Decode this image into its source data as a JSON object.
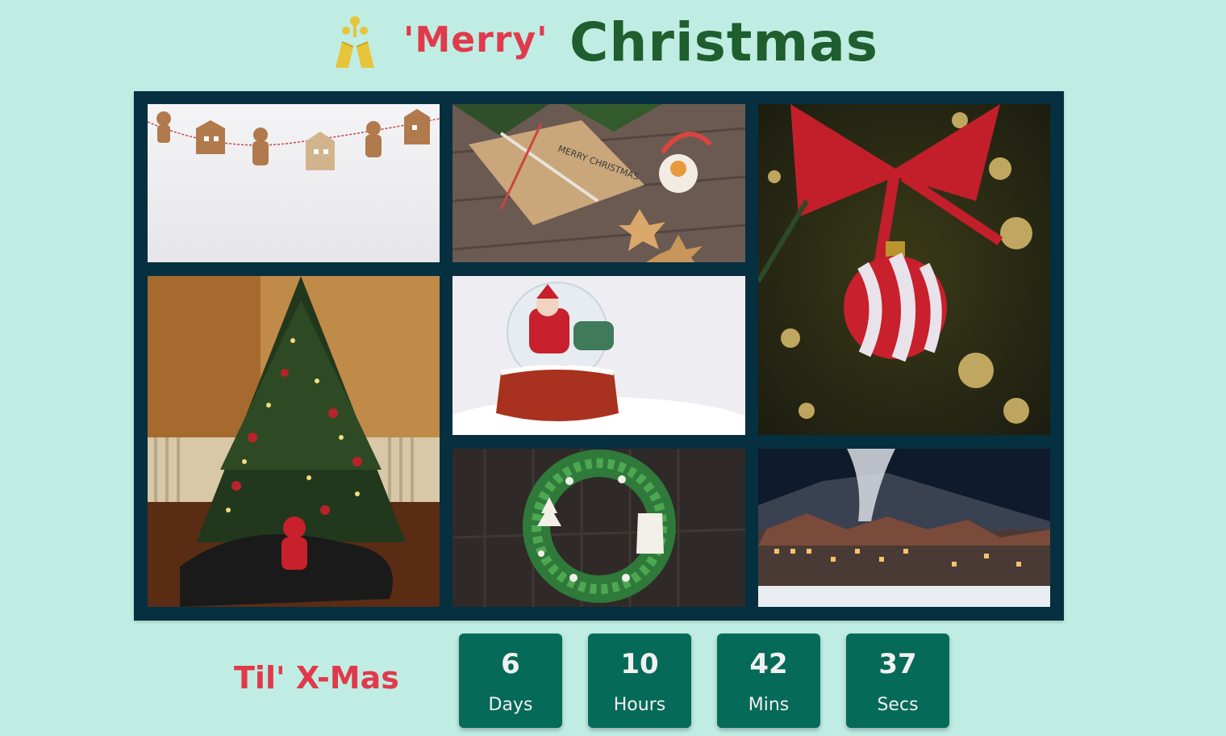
{
  "header": {
    "logo_icon": "bells-icon",
    "merry": "'Merry'",
    "christmas": "Christmas"
  },
  "gallery": {
    "photos": [
      {
        "name": "gingerbread-garland"
      },
      {
        "name": "wrapped-gift",
        "label": "MERRY CHRISTMAS"
      },
      {
        "name": "ornament-bauble"
      },
      {
        "name": "christmas-tree"
      },
      {
        "name": "snow-globe"
      },
      {
        "name": "wreath"
      },
      {
        "name": "snowy-village"
      }
    ]
  },
  "countdown": {
    "label": "Til' X-Mas",
    "days": {
      "value": "6",
      "unit": "Days"
    },
    "hours": {
      "value": "10",
      "unit": "Hours"
    },
    "mins": {
      "value": "42",
      "unit": "Mins"
    },
    "secs": {
      "value": "37",
      "unit": "Secs"
    }
  },
  "colors": {
    "background": "#c0ede3",
    "frame": "#062f3f",
    "accent_red": "#e03a4c",
    "title_green": "#1f5e2e",
    "box_green": "#066a58"
  }
}
